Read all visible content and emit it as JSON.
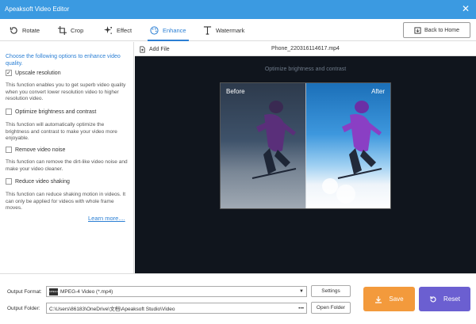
{
  "window": {
    "title": "Apeaksoft Video Editor",
    "close_glyph": "✕"
  },
  "tabs": [
    {
      "label": "Rotate",
      "icon": "rotate-icon"
    },
    {
      "label": "Crop",
      "icon": "crop-icon"
    },
    {
      "label": "Effect",
      "icon": "effect-icon"
    },
    {
      "label": "Enhance",
      "icon": "palette-icon",
      "active": true
    },
    {
      "label": "Watermark",
      "icon": "text-icon"
    }
  ],
  "back_button": {
    "label": "Back to Home",
    "icon": "home-icon"
  },
  "enhance": {
    "intro": "Choose the following options to enhance video quality.",
    "options": [
      {
        "label": "Upscale resolution",
        "checked": true,
        "desc": "This function enables you to get superb video quality when you convert lower resolution video to higher resolution video."
      },
      {
        "label": "Optimize brightness and contrast",
        "checked": false,
        "desc": "This function will automatically optimize the brightness and contrast to make your video more enjoyable."
      },
      {
        "label": "Remove video noise",
        "checked": false,
        "desc": "This function can remove the dirt-like video noise and make your video cleaner."
      },
      {
        "label": "Reduce video shaking",
        "checked": false,
        "desc": "This function can reduce shaking motion in videos. It can only be applied for videos with whole frame moves."
      }
    ],
    "learn_more": "Learn more...."
  },
  "preview": {
    "add_file": "Add File",
    "filename": "Phone_220316114617.mp4",
    "hint": "Optimize brightness and contrast",
    "before_label": "Before",
    "after_label": "After"
  },
  "output": {
    "format_label": "Output Format:",
    "format_value": "MPEG-4 Video (*.mp4)",
    "format_icon_text": "MPEG4",
    "settings": "Settings",
    "folder_label": "Output Folder:",
    "folder_value": "C:\\Users\\86183\\OneDrive\\文档\\Apeaksoft Studio\\Video",
    "browse": "•••",
    "open_folder": "Open Folder"
  },
  "actions": {
    "save": "Save",
    "reset": "Reset"
  },
  "colors": {
    "accent": "#2b7fd4",
    "titlebar": "#3b9ae1",
    "save": "#f39a3c",
    "reset": "#6b5fd1",
    "preview_bg": "#10151d"
  }
}
